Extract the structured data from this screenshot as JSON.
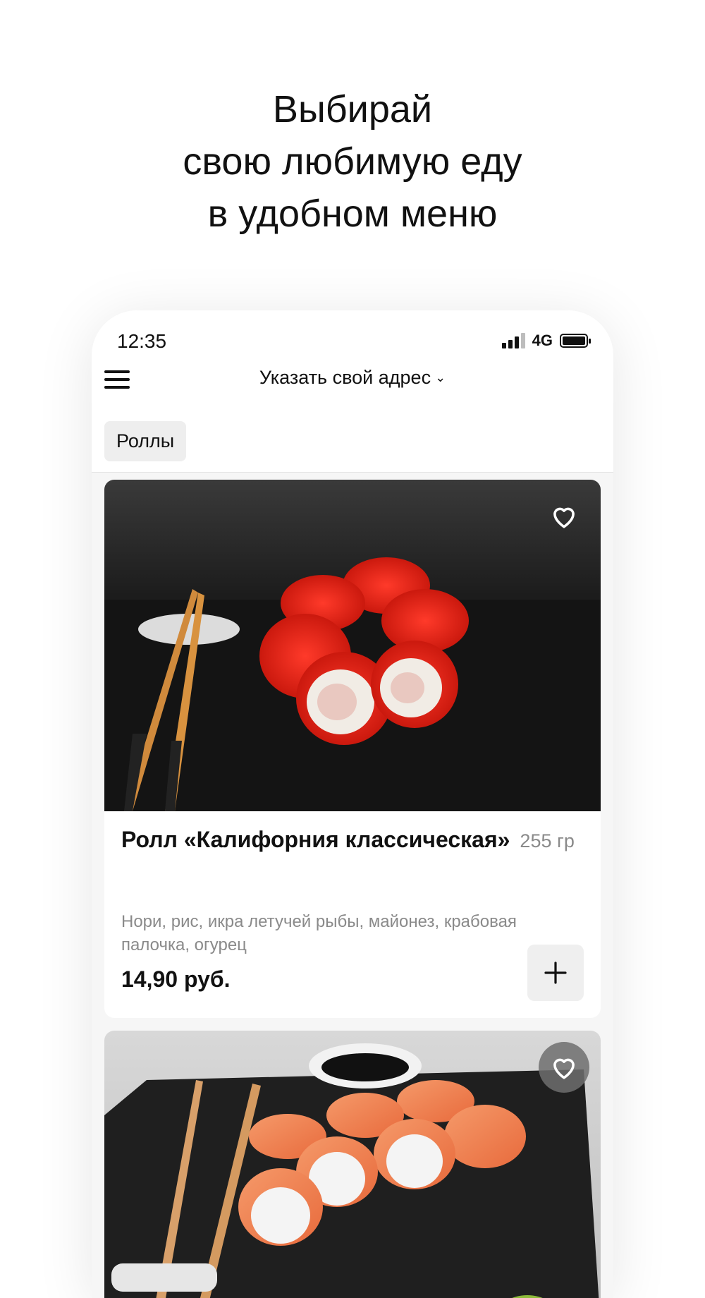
{
  "promo": {
    "line1": "Выбирай",
    "line2": "свою любимую еду",
    "line3": "в удобном меню"
  },
  "status_bar": {
    "time": "12:35",
    "network": "4G"
  },
  "header": {
    "address_label": "Указать свой адрес",
    "address_chevron": "⌄"
  },
  "categories": [
    {
      "label": "Роллы"
    }
  ],
  "products": [
    {
      "title": "Ролл «Калифорния классическая»",
      "weight": "255 гр",
      "description": "Нори, рис, икра летучей рыбы, майонез, крабовая палочка, огурец",
      "price": "14,90 руб.",
      "add_icon": "plus-icon",
      "favorite_icon": "heart-outline-icon"
    },
    {
      "favorite_icon": "heart-outline-icon"
    }
  ]
}
